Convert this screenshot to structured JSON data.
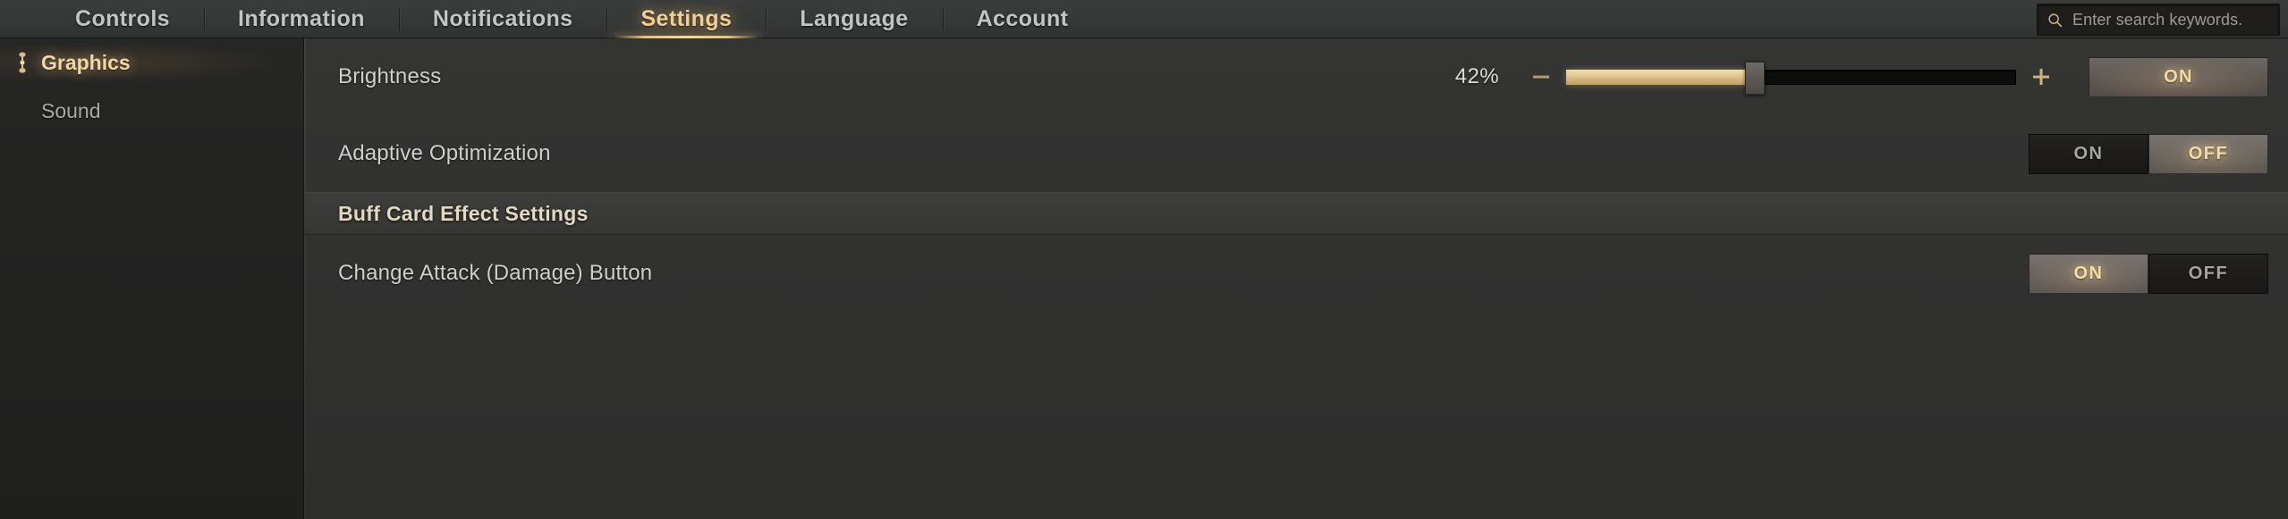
{
  "topnav": {
    "tabs": [
      {
        "label": "Controls",
        "active": false
      },
      {
        "label": "Information",
        "active": false
      },
      {
        "label": "Notifications",
        "active": false
      },
      {
        "label": "Settings",
        "active": true
      },
      {
        "label": "Language",
        "active": false
      },
      {
        "label": "Account",
        "active": false
      }
    ]
  },
  "search": {
    "icon": "search-icon",
    "placeholder": "Enter search keywords.",
    "value": ""
  },
  "sidebar": {
    "items": [
      {
        "label": "Graphics",
        "active": true,
        "icon": "ornament-icon"
      },
      {
        "label": "Sound",
        "active": false,
        "icon": ""
      }
    ]
  },
  "main": {
    "rows": [
      {
        "label": "Brightness",
        "control": "slider",
        "percent_text": "42%",
        "percent_value": 42,
        "minus_icon": "minus-icon",
        "plus_icon": "plus-icon",
        "button_label": "ON"
      },
      {
        "label": "Adaptive Optimization",
        "control": "segmented",
        "on_label": "ON",
        "off_label": "OFF",
        "selected": "OFF"
      }
    ],
    "section": {
      "title": "Buff Card Effect Settings",
      "rows": [
        {
          "label": "Change Attack (Damage) Button",
          "control": "segmented",
          "on_label": "ON",
          "off_label": "OFF",
          "selected": "ON"
        }
      ]
    }
  },
  "colors": {
    "accent_gold": "#f0cf92",
    "accent_gold_bright": "#f6dba8",
    "slider_fill": "#e3cb94",
    "text_primary": "#cfd0ce",
    "text_muted": "#a4a5a3",
    "bg_content": "#313130",
    "bg_sidebar": "#232322",
    "bg_topbar": "#363837"
  }
}
